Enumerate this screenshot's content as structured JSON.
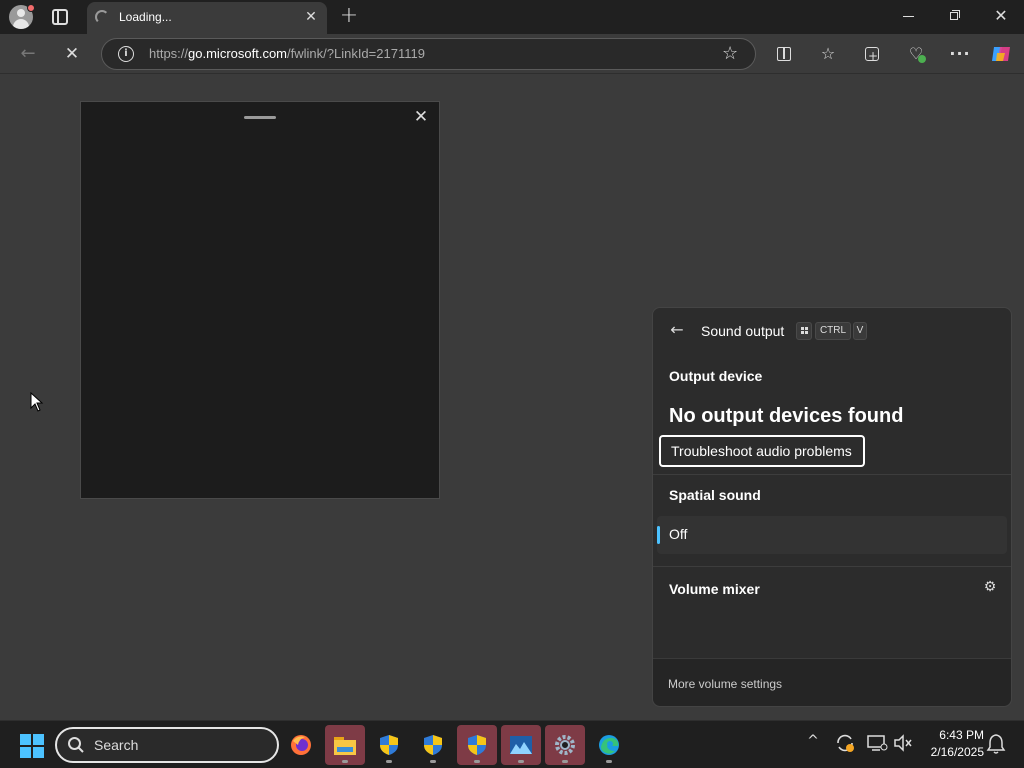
{
  "browser": {
    "tab_title": "Loading...",
    "url_prefix": "https://",
    "url_domain": "go.microsoft.com",
    "url_path": "/fwlink/?LinkId=2171119",
    "icons": [
      "profile-icon",
      "tab-actions-icon",
      "loading-spinner-icon",
      "close-icon",
      "plus-icon",
      "minimize-icon",
      "restore-icon",
      "close-icon",
      "back-arrow-icon",
      "stop-icon",
      "info-icon",
      "star-icon",
      "split-screen-icon",
      "favorites-icon",
      "collections-icon",
      "browser-essentials-icon",
      "more-icon",
      "copilot-icon"
    ]
  },
  "sound_flyout": {
    "title": "Sound output",
    "shortcut": {
      "key1": "CTRL",
      "key2": "V"
    },
    "output_heading": "Output device",
    "no_devices": "No output devices found",
    "troubleshoot_button": "Troubleshoot audio problems",
    "spatial_heading": "Spatial sound",
    "spatial_value": "Off",
    "mixer_heading": "Volume mixer",
    "more_settings": "More volume settings",
    "accent_color": "#4cc2ff"
  },
  "taskbar": {
    "search_placeholder": "Search",
    "apps": [
      "firefox-icon",
      "file-explorer-icon",
      "security-shield-icon",
      "security-shield-icon",
      "security-shield-icon",
      "image-viewer-icon",
      "settings-icon",
      "edge-icon"
    ],
    "clock_time": "6:43 PM",
    "clock_date": "2/16/2025"
  }
}
